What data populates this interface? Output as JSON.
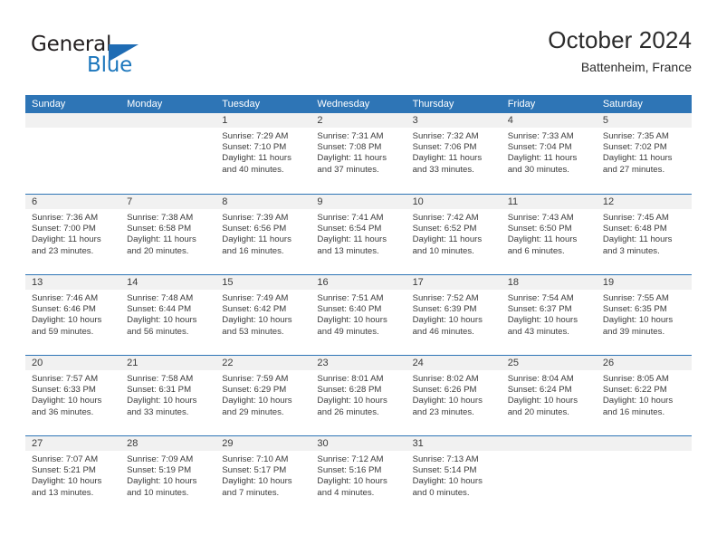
{
  "logo": {
    "word_top": "General",
    "word_bottom": "Blue",
    "triangle_color": "#1f6cb4",
    "blue_color": "#1b76bc"
  },
  "header": {
    "title": "October 2024",
    "location": "Battenheim, France"
  },
  "theme": {
    "header_blue": "#2e75b6",
    "daynum_band": "#f1f1f1",
    "text": "#3b3b3b"
  },
  "weekdays": [
    "Sunday",
    "Monday",
    "Tuesday",
    "Wednesday",
    "Thursday",
    "Friday",
    "Saturday"
  ],
  "weeks": [
    [
      {
        "day": "",
        "sunrise": "",
        "sunset": "",
        "daylight": "",
        "empty": true
      },
      {
        "day": "",
        "sunrise": "",
        "sunset": "",
        "daylight": "",
        "empty": true
      },
      {
        "day": "1",
        "sunrise": "Sunrise: 7:29 AM",
        "sunset": "Sunset: 7:10 PM",
        "daylight": "Daylight: 11 hours and 40 minutes."
      },
      {
        "day": "2",
        "sunrise": "Sunrise: 7:31 AM",
        "sunset": "Sunset: 7:08 PM",
        "daylight": "Daylight: 11 hours and 37 minutes."
      },
      {
        "day": "3",
        "sunrise": "Sunrise: 7:32 AM",
        "sunset": "Sunset: 7:06 PM",
        "daylight": "Daylight: 11 hours and 33 minutes."
      },
      {
        "day": "4",
        "sunrise": "Sunrise: 7:33 AM",
        "sunset": "Sunset: 7:04 PM",
        "daylight": "Daylight: 11 hours and 30 minutes."
      },
      {
        "day": "5",
        "sunrise": "Sunrise: 7:35 AM",
        "sunset": "Sunset: 7:02 PM",
        "daylight": "Daylight: 11 hours and 27 minutes."
      }
    ],
    [
      {
        "day": "6",
        "sunrise": "Sunrise: 7:36 AM",
        "sunset": "Sunset: 7:00 PM",
        "daylight": "Daylight: 11 hours and 23 minutes."
      },
      {
        "day": "7",
        "sunrise": "Sunrise: 7:38 AM",
        "sunset": "Sunset: 6:58 PM",
        "daylight": "Daylight: 11 hours and 20 minutes."
      },
      {
        "day": "8",
        "sunrise": "Sunrise: 7:39 AM",
        "sunset": "Sunset: 6:56 PM",
        "daylight": "Daylight: 11 hours and 16 minutes."
      },
      {
        "day": "9",
        "sunrise": "Sunrise: 7:41 AM",
        "sunset": "Sunset: 6:54 PM",
        "daylight": "Daylight: 11 hours and 13 minutes."
      },
      {
        "day": "10",
        "sunrise": "Sunrise: 7:42 AM",
        "sunset": "Sunset: 6:52 PM",
        "daylight": "Daylight: 11 hours and 10 minutes."
      },
      {
        "day": "11",
        "sunrise": "Sunrise: 7:43 AM",
        "sunset": "Sunset: 6:50 PM",
        "daylight": "Daylight: 11 hours and 6 minutes."
      },
      {
        "day": "12",
        "sunrise": "Sunrise: 7:45 AM",
        "sunset": "Sunset: 6:48 PM",
        "daylight": "Daylight: 11 hours and 3 minutes."
      }
    ],
    [
      {
        "day": "13",
        "sunrise": "Sunrise: 7:46 AM",
        "sunset": "Sunset: 6:46 PM",
        "daylight": "Daylight: 10 hours and 59 minutes."
      },
      {
        "day": "14",
        "sunrise": "Sunrise: 7:48 AM",
        "sunset": "Sunset: 6:44 PM",
        "daylight": "Daylight: 10 hours and 56 minutes."
      },
      {
        "day": "15",
        "sunrise": "Sunrise: 7:49 AM",
        "sunset": "Sunset: 6:42 PM",
        "daylight": "Daylight: 10 hours and 53 minutes."
      },
      {
        "day": "16",
        "sunrise": "Sunrise: 7:51 AM",
        "sunset": "Sunset: 6:40 PM",
        "daylight": "Daylight: 10 hours and 49 minutes."
      },
      {
        "day": "17",
        "sunrise": "Sunrise: 7:52 AM",
        "sunset": "Sunset: 6:39 PM",
        "daylight": "Daylight: 10 hours and 46 minutes."
      },
      {
        "day": "18",
        "sunrise": "Sunrise: 7:54 AM",
        "sunset": "Sunset: 6:37 PM",
        "daylight": "Daylight: 10 hours and 43 minutes."
      },
      {
        "day": "19",
        "sunrise": "Sunrise: 7:55 AM",
        "sunset": "Sunset: 6:35 PM",
        "daylight": "Daylight: 10 hours and 39 minutes."
      }
    ],
    [
      {
        "day": "20",
        "sunrise": "Sunrise: 7:57 AM",
        "sunset": "Sunset: 6:33 PM",
        "daylight": "Daylight: 10 hours and 36 minutes."
      },
      {
        "day": "21",
        "sunrise": "Sunrise: 7:58 AM",
        "sunset": "Sunset: 6:31 PM",
        "daylight": "Daylight: 10 hours and 33 minutes."
      },
      {
        "day": "22",
        "sunrise": "Sunrise: 7:59 AM",
        "sunset": "Sunset: 6:29 PM",
        "daylight": "Daylight: 10 hours and 29 minutes."
      },
      {
        "day": "23",
        "sunrise": "Sunrise: 8:01 AM",
        "sunset": "Sunset: 6:28 PM",
        "daylight": "Daylight: 10 hours and 26 minutes."
      },
      {
        "day": "24",
        "sunrise": "Sunrise: 8:02 AM",
        "sunset": "Sunset: 6:26 PM",
        "daylight": "Daylight: 10 hours and 23 minutes."
      },
      {
        "day": "25",
        "sunrise": "Sunrise: 8:04 AM",
        "sunset": "Sunset: 6:24 PM",
        "daylight": "Daylight: 10 hours and 20 minutes."
      },
      {
        "day": "26",
        "sunrise": "Sunrise: 8:05 AM",
        "sunset": "Sunset: 6:22 PM",
        "daylight": "Daylight: 10 hours and 16 minutes."
      }
    ],
    [
      {
        "day": "27",
        "sunrise": "Sunrise: 7:07 AM",
        "sunset": "Sunset: 5:21 PM",
        "daylight": "Daylight: 10 hours and 13 minutes."
      },
      {
        "day": "28",
        "sunrise": "Sunrise: 7:09 AM",
        "sunset": "Sunset: 5:19 PM",
        "daylight": "Daylight: 10 hours and 10 minutes."
      },
      {
        "day": "29",
        "sunrise": "Sunrise: 7:10 AM",
        "sunset": "Sunset: 5:17 PM",
        "daylight": "Daylight: 10 hours and 7 minutes."
      },
      {
        "day": "30",
        "sunrise": "Sunrise: 7:12 AM",
        "sunset": "Sunset: 5:16 PM",
        "daylight": "Daylight: 10 hours and 4 minutes."
      },
      {
        "day": "31",
        "sunrise": "Sunrise: 7:13 AM",
        "sunset": "Sunset: 5:14 PM",
        "daylight": "Daylight: 10 hours and 0 minutes."
      },
      {
        "day": "",
        "sunrise": "",
        "sunset": "",
        "daylight": "",
        "empty": true
      },
      {
        "day": "",
        "sunrise": "",
        "sunset": "",
        "daylight": "",
        "empty": true
      }
    ]
  ]
}
